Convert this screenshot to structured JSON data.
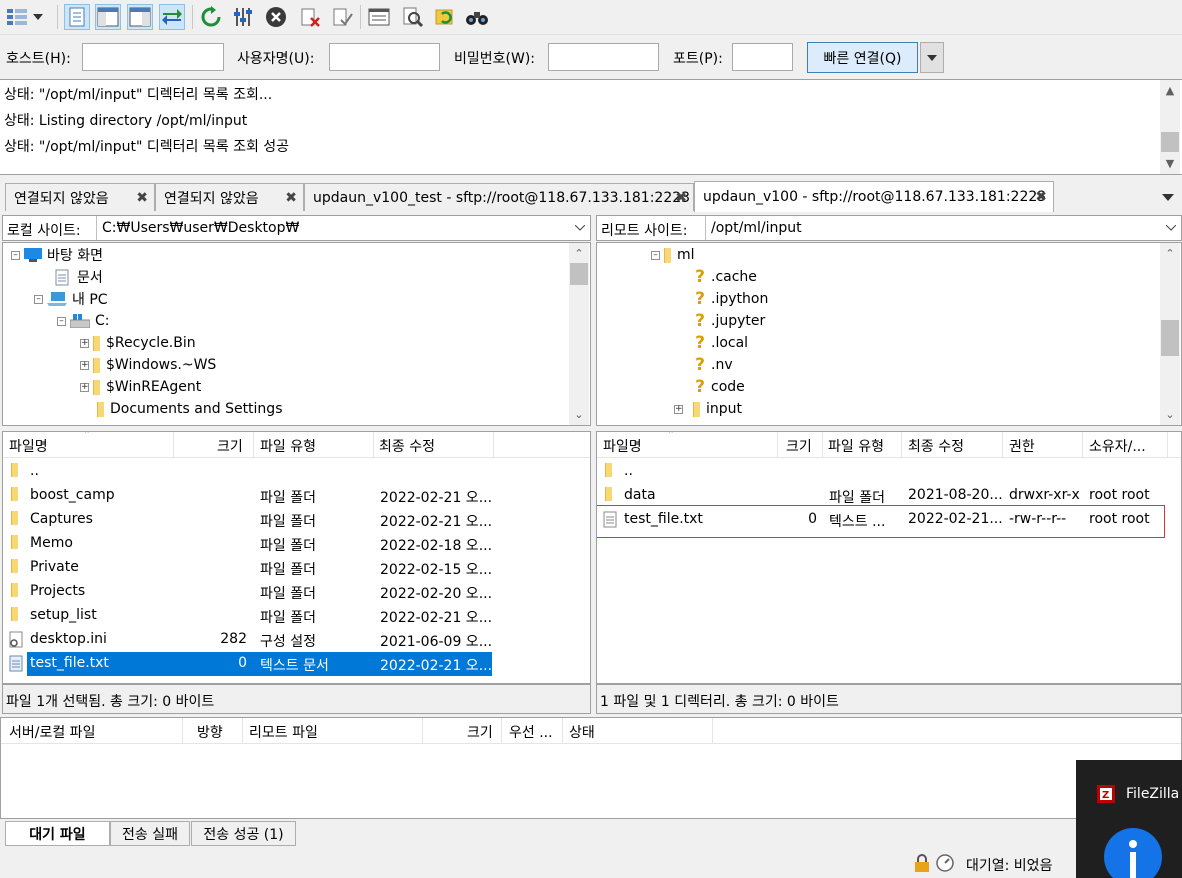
{
  "toolbar": {
    "icons": [
      "site-manager-icon",
      "dropdown-arrow-icon",
      "toggle-log-icon",
      "toggle-local-tree-icon",
      "toggle-remote-tree-icon",
      "toggle-queue-icon",
      "refresh-icon",
      "process-queue-icon",
      "cancel-icon",
      "disconnect-icon",
      "reconnect-icon",
      "filter-icon",
      "search-icon",
      "sync-browse-icon",
      "find-icon"
    ]
  },
  "quickconnect": {
    "host_label": "호스트(H):",
    "host_value": "",
    "user_label": "사용자명(U):",
    "user_value": "",
    "pass_label": "비밀번호(W):",
    "pass_value": "",
    "port_label": "포트(P):",
    "port_value": "",
    "connect_label": "빠른 연결(Q)"
  },
  "log": [
    "상태:  \"/opt/ml/input\" 디렉터리 목록 조회...",
    "상태:  Listing directory /opt/ml/input",
    "상태:  \"/opt/ml/input\" 디렉터리 목록 조회 성공"
  ],
  "tabs": [
    {
      "label": "연결되지 않았음"
    },
    {
      "label": "연결되지 않았음"
    },
    {
      "label": "updaun_v100_test - sftp://root@118.67.133.181:2223"
    },
    {
      "label": "updaun_v100 - sftp://root@118.67.133.181:2223"
    }
  ],
  "local": {
    "site_label": "로컬 사이트:",
    "site_path": "C:₩Users₩user₩Desktop₩",
    "tree": [
      "바탕 화면",
      "문서",
      "내 PC",
      "C:",
      "$Recycle.Bin",
      "$Windows.~WS",
      "$WinREAgent",
      "Documents and Settings"
    ],
    "columns": [
      "파일명",
      "크기",
      "파일 유형",
      "최종 수정"
    ],
    "files": [
      {
        "name": "..",
        "size": "",
        "type": "",
        "modified": ""
      },
      {
        "name": "boost_camp",
        "size": "",
        "type": "파일 폴더",
        "modified": "2022-02-21 오..."
      },
      {
        "name": "Captures",
        "size": "",
        "type": "파일 폴더",
        "modified": "2022-02-21 오..."
      },
      {
        "name": "Memo",
        "size": "",
        "type": "파일 폴더",
        "modified": "2022-02-18 오..."
      },
      {
        "name": "Private",
        "size": "",
        "type": "파일 폴더",
        "modified": "2022-02-15 오..."
      },
      {
        "name": "Projects",
        "size": "",
        "type": "파일 폴더",
        "modified": "2022-02-20 오..."
      },
      {
        "name": "setup_list",
        "size": "",
        "type": "파일 폴더",
        "modified": "2022-02-21 오..."
      },
      {
        "name": "desktop.ini",
        "size": "282",
        "type": "구성 설정",
        "modified": "2021-06-09 오..."
      },
      {
        "name": "test_file.txt",
        "size": "0",
        "type": "텍스트 문서",
        "modified": "2022-02-21 오..."
      }
    ],
    "status": "파일 1개 선택됨. 총 크기: 0 바이트"
  },
  "remote": {
    "site_label": "리모트 사이트:",
    "site_path": "/opt/ml/input",
    "tree": [
      "ml",
      ".cache",
      ".ipython",
      ".jupyter",
      ".local",
      ".nv",
      "code",
      "input"
    ],
    "columns": [
      "파일명",
      "크기",
      "파일 유형",
      "최종 수정",
      "권한",
      "소유자/..."
    ],
    "files": [
      {
        "name": "..",
        "size": "",
        "type": "",
        "modified": "",
        "perm": "",
        "owner": ""
      },
      {
        "name": "data",
        "size": "",
        "type": "파일 폴더",
        "modified": "2021-08-20...",
        "perm": "drwxr-xr-x",
        "owner": "root root"
      },
      {
        "name": "test_file.txt",
        "size": "0",
        "type": "텍스트 ...",
        "modified": "2022-02-21...",
        "perm": "-rw-r--r--",
        "owner": "root root"
      }
    ],
    "status": "1 파일 및 1 디렉터리. 총 크기: 0 바이트"
  },
  "queue": {
    "columns": [
      "서버/로컬 파일",
      "방향",
      "리모트 파일",
      "크기",
      "우선 ...",
      "상태"
    ],
    "tabs": [
      "대기 파일",
      "전송 실패",
      "전송 성공 (1)"
    ]
  },
  "statusbar": {
    "queue_text": "대기열: 비었음"
  },
  "notification": {
    "app_name": "FileZilla"
  },
  "colors": {
    "selection": "#0078d7",
    "highlight_box": "#e0303a",
    "folder": "#f8d775"
  }
}
